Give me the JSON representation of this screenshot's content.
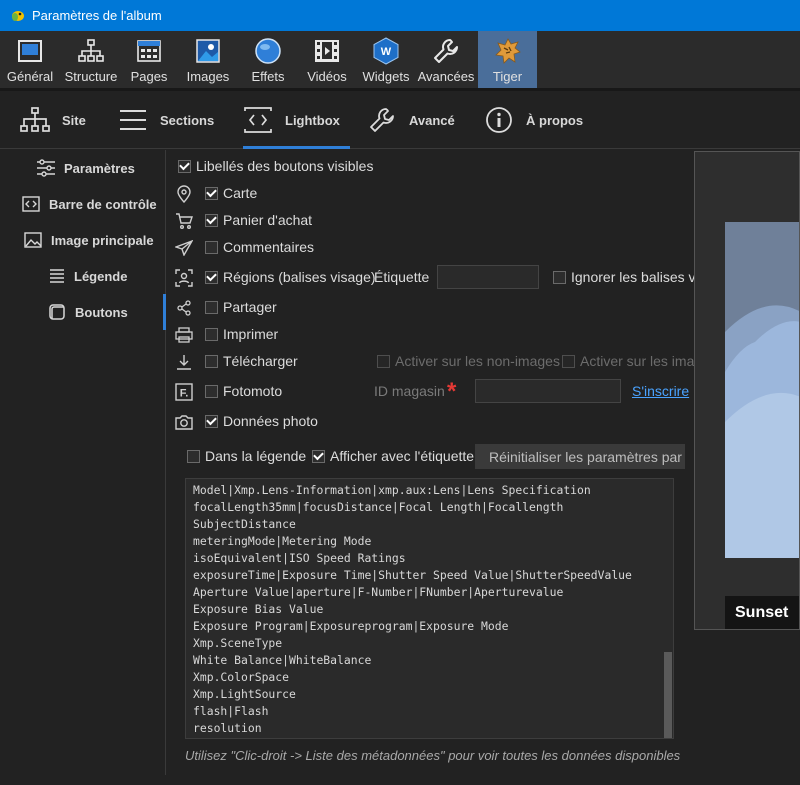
{
  "window": {
    "title": "Paramètres de l'album"
  },
  "toolbar": {
    "items": [
      {
        "label": "Général",
        "icon": "window-icon"
      },
      {
        "label": "Structure",
        "icon": "structure-icon"
      },
      {
        "label": "Pages",
        "icon": "pages-icon"
      },
      {
        "label": "Images",
        "icon": "image-icon"
      },
      {
        "label": "Effets",
        "icon": "effects-icon"
      },
      {
        "label": "Vidéos",
        "icon": "film-icon"
      },
      {
        "label": "Widgets",
        "icon": "widgets-icon"
      },
      {
        "label": "Avancées",
        "icon": "wrench-icon"
      },
      {
        "label": "Tiger",
        "icon": "tiger-skin-icon",
        "active": true
      }
    ]
  },
  "tabs": [
    {
      "label": "Site",
      "icon": "sitemap-icon"
    },
    {
      "label": "Sections",
      "icon": "hamburger-icon"
    },
    {
      "label": "Lightbox",
      "icon": "code-frame-icon",
      "active": true
    },
    {
      "label": "Avancé",
      "icon": "wrench-icon"
    },
    {
      "label": "À propos",
      "icon": "info-icon"
    }
  ],
  "leftnav": {
    "items": [
      {
        "label": "Paramètres",
        "icon": "sliders-icon"
      },
      {
        "label": "Barre de contrôle",
        "icon": "code-icon"
      },
      {
        "label": "Image principale",
        "icon": "image-icon"
      },
      {
        "label": "Légende",
        "icon": "lines-icon"
      },
      {
        "label": "Boutons",
        "icon": "square-icon",
        "active": true
      }
    ]
  },
  "form": {
    "labels_visible": {
      "label": "Libellés des boutons visibles",
      "checked": true
    },
    "map": {
      "label": "Carte",
      "checked": true
    },
    "cart": {
      "label": "Panier d'achat",
      "checked": true
    },
    "comments": {
      "label": "Commentaires",
      "checked": false
    },
    "regions": {
      "label": "Régions (balises visage)",
      "checked": true,
      "tag_label": "Étiquette",
      "tag_value": "",
      "ignore_label": "Ignorer les balises vid",
      "ignore_checked": false
    },
    "share": {
      "label": "Partager",
      "checked": false
    },
    "print": {
      "label": "Imprimer",
      "checked": false
    },
    "download": {
      "label": "Télécharger",
      "checked": false,
      "non_images_label": "Activer sur les non-images",
      "images_label": "Activer sur les imag"
    },
    "fotomoto": {
      "label": "Fotomoto",
      "checked": false,
      "store_id_label": "ID magasin",
      "store_id_value": "",
      "required_mark": "*",
      "signup_link": "S'inscrire"
    },
    "photo_data": {
      "label": "Données photo",
      "checked": true
    },
    "in_caption": {
      "label": "Dans la légende",
      "checked": false
    },
    "show_with_label": {
      "label": "Afficher avec l'étiquette",
      "checked": true
    },
    "reset_button": "Réinitialiser les paramètres par dé"
  },
  "metadata_lines": [
    "Model|Xmp.Lens-Information|xmp.aux:Lens|Lens Specification",
    "focalLength35mm|focusDistance|Focal Length|Focallength",
    "SubjectDistance",
    "meteringMode|Metering Mode",
    "isoEquivalent|ISO Speed Ratings",
    "exposureTime|Exposure Time|Shutter Speed Value|ShutterSpeedValue",
    "Aperture Value|aperture|F-Number|FNumber|Aperturevalue",
    "Exposure Bias Value",
    "Exposure Program|Exposureprogram|Exposure Mode",
    "Xmp.SceneType",
    "White Balance|WhiteBalance",
    "Xmp.ColorSpace",
    "Xmp.LightSource",
    "flash|Flash",
    "resolution"
  ],
  "hint": "Utilisez \"Clic-droit -> Liste des métadonnées\" pour voir toutes les données disponibles",
  "preview": {
    "caption": "Sunset"
  }
}
